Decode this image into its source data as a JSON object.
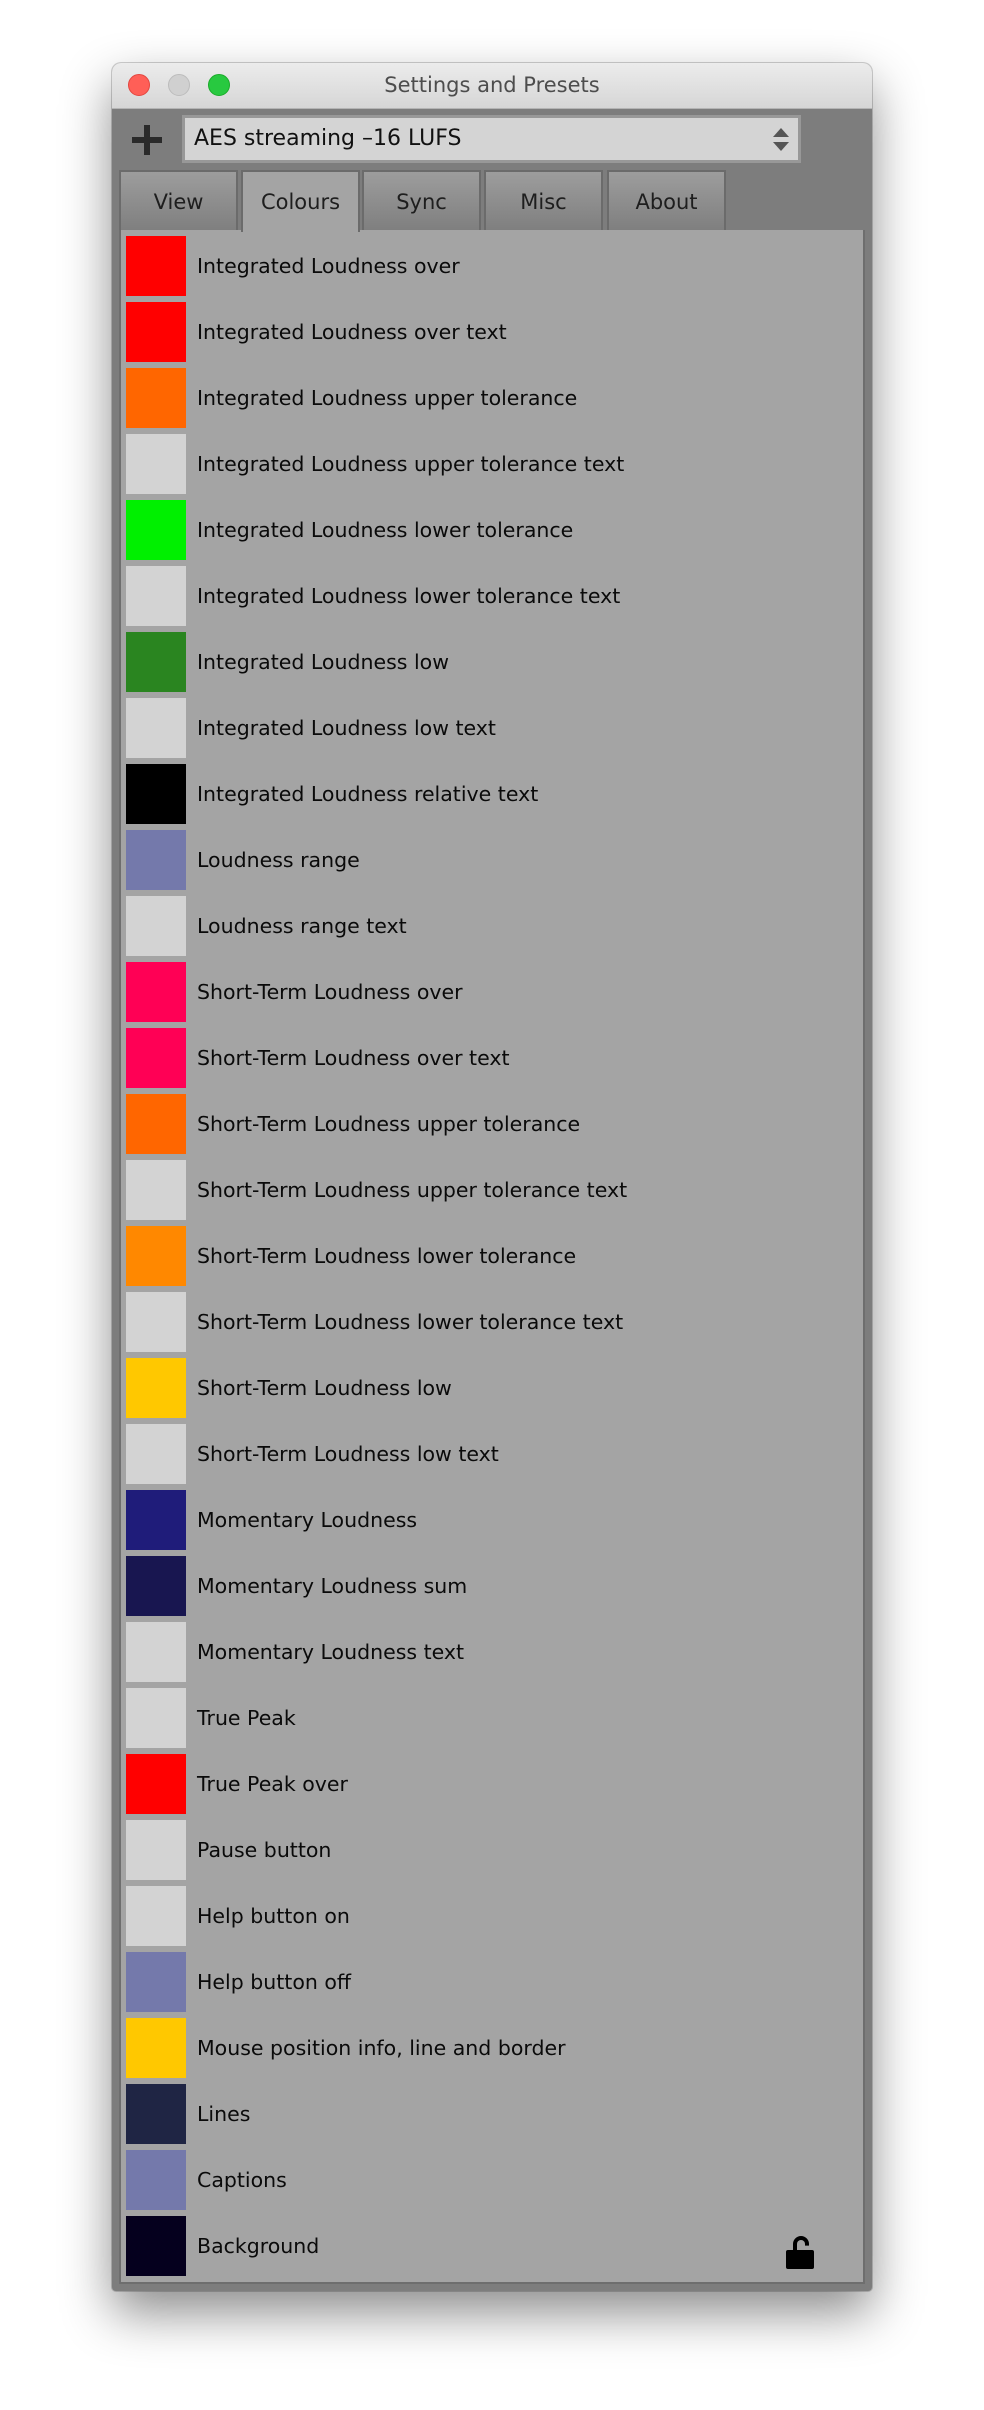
{
  "window": {
    "title": "Settings and Presets",
    "controls": {
      "close_color": "#FF5F57",
      "minimize_color": "#D0D0D0",
      "zoom_color": "#28C940"
    }
  },
  "toolbar": {
    "add_icon": "plus-icon",
    "preset": {
      "selected_value": "AES streaming –16 LUFS",
      "icon": "up-down-arrows-icon"
    }
  },
  "tabs": [
    {
      "label": "View",
      "active": false
    },
    {
      "label": "Colours",
      "active": true
    },
    {
      "label": "Sync",
      "active": false
    },
    {
      "label": "Misc",
      "active": false
    },
    {
      "label": "About",
      "active": false
    }
  ],
  "colours": [
    {
      "label": "Integrated Loudness over",
      "color": "#FF0000"
    },
    {
      "label": "Integrated Loudness over text",
      "color": "#FF0000"
    },
    {
      "label": "Integrated Loudness upper tolerance",
      "color": "#FF6600"
    },
    {
      "label": "Integrated Loudness upper tolerance text",
      "color": "#D3D3D3"
    },
    {
      "label": "Integrated Loudness lower tolerance",
      "color": "#00F000"
    },
    {
      "label": "Integrated Loudness lower tolerance text",
      "color": "#D3D3D3"
    },
    {
      "label": "Integrated Loudness low",
      "color": "#2A8520"
    },
    {
      "label": "Integrated Loudness low text",
      "color": "#D3D3D3"
    },
    {
      "label": "Integrated Loudness relative text",
      "color": "#000000"
    },
    {
      "label": "Loudness range",
      "color": "#7479AB"
    },
    {
      "label": "Loudness range text",
      "color": "#D3D3D3"
    },
    {
      "label": "Short-Term Loudness over",
      "color": "#FF0055"
    },
    {
      "label": "Short-Term Loudness over text",
      "color": "#FF0055"
    },
    {
      "label": "Short-Term Loudness upper tolerance",
      "color": "#FF6600"
    },
    {
      "label": "Short-Term Loudness upper tolerance text",
      "color": "#D3D3D3"
    },
    {
      "label": "Short-Term Loudness lower tolerance",
      "color": "#FF8800"
    },
    {
      "label": "Short-Term Loudness lower tolerance text",
      "color": "#D3D3D3"
    },
    {
      "label": "Short-Term Loudness low",
      "color": "#FFC800"
    },
    {
      "label": "Short-Term Loudness low text",
      "color": "#D3D3D3"
    },
    {
      "label": "Momentary Loudness",
      "color": "#1F1C7A"
    },
    {
      "label": "Momentary Loudness sum",
      "color": "#181650"
    },
    {
      "label": "Momentary Loudness text",
      "color": "#D3D3D3"
    },
    {
      "label": "True Peak",
      "color": "#D3D3D3"
    },
    {
      "label": "True Peak over",
      "color": "#FF0000"
    },
    {
      "label": "Pause button",
      "color": "#D3D3D3"
    },
    {
      "label": "Help button on",
      "color": "#D3D3D3"
    },
    {
      "label": "Help button off",
      "color": "#7479AB"
    },
    {
      "label": "Mouse position info, line and border",
      "color": "#FFC800"
    },
    {
      "label": "Lines",
      "color": "#1F2544"
    },
    {
      "label": "Captions",
      "color": "#7479AB"
    },
    {
      "label": "Background",
      "color": "#05001E"
    }
  ],
  "lock": {
    "icon": "unlocked-padlock-icon",
    "state": "unlocked"
  }
}
